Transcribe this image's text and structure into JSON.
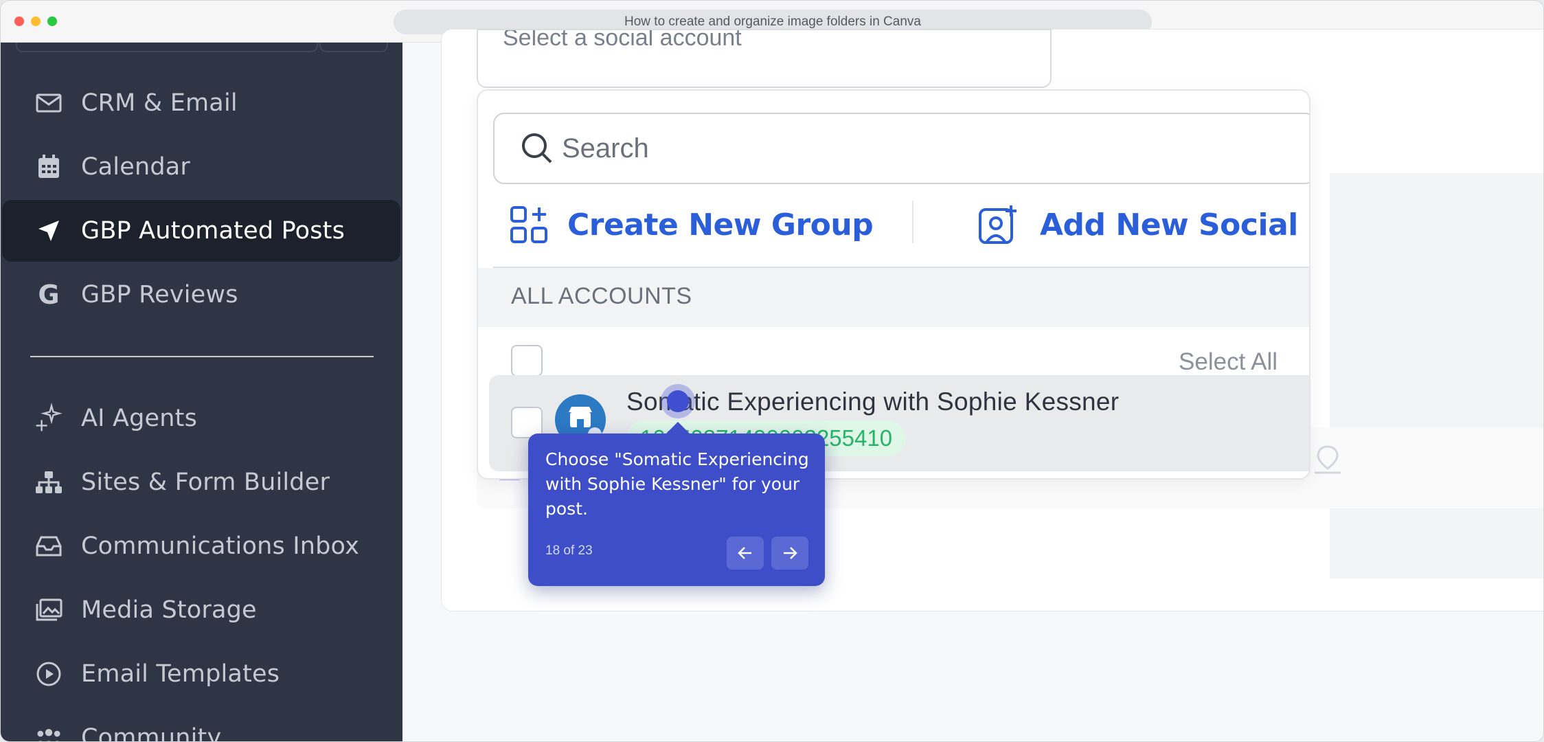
{
  "window": {
    "title": "How to create and organize image folders in Canva"
  },
  "sidebar": {
    "items": [
      {
        "label": "CRM & Email",
        "icon": "mail-icon"
      },
      {
        "label": "Calendar",
        "icon": "calendar-icon"
      },
      {
        "label": "GBP Automated Posts",
        "icon": "send-icon",
        "active": true
      },
      {
        "label": "GBP Reviews",
        "icon": "google-icon"
      },
      {
        "label": "AI Agents",
        "icon": "sparkles-icon"
      },
      {
        "label": "Sites & Form Builder",
        "icon": "sitemap-icon"
      },
      {
        "label": "Communications Inbox",
        "icon": "inbox-icon"
      },
      {
        "label": "Media Storage",
        "icon": "images-icon"
      },
      {
        "label": "Email Templates",
        "icon": "play-circle-icon"
      },
      {
        "label": "Community",
        "icon": "users-icon"
      }
    ]
  },
  "main": {
    "social_select_placeholder": "Select a social account"
  },
  "dropdown": {
    "search_placeholder": "Search",
    "create_group_label": "Create New Group",
    "add_social_label": "Add New Social",
    "section_header": "ALL ACCOUNTS",
    "select_all_label": "Select All",
    "accounts": [
      {
        "name": "Somatic Experiencing with Sophie Kessner",
        "id": "10050871490002255410"
      }
    ]
  },
  "tooltip": {
    "text": "Choose \"Somatic Experiencing with Sophie Kessner\" for your post.",
    "step": "18 of 23"
  },
  "colors": {
    "sidebar_bg": "#2e3646",
    "accent_blue": "#2b5fd9",
    "tooltip_bg": "#3d4ec8",
    "id_badge_text": "#29b36a"
  }
}
